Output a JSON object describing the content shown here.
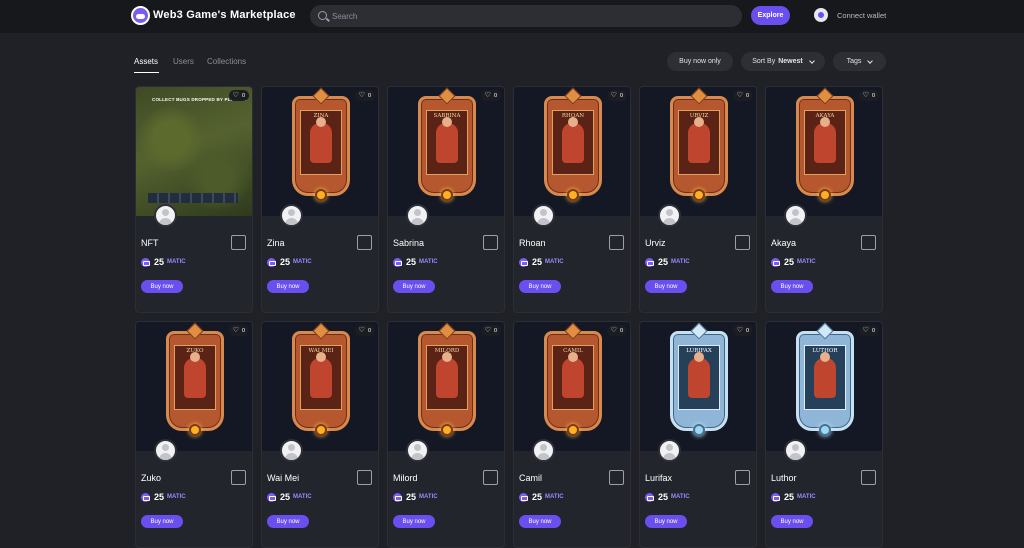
{
  "header": {
    "brand": "Web3 Game's Marketplace",
    "search_placeholder": "Search",
    "explore_label": "Explore",
    "wallet_label": "Connect wallet"
  },
  "tabs": [
    {
      "label": "Assets",
      "active": true
    },
    {
      "label": "Users",
      "active": false
    },
    {
      "label": "Collections",
      "active": false
    }
  ],
  "filters": {
    "buy_now": "Buy now only",
    "sort_prefix": "Sort By",
    "sort_value": "Newest",
    "tags": "Tags"
  },
  "nft_caption": "COLLECT BUGS DROPPED BY PLAYERS",
  "cards": [
    {
      "name": "NFT",
      "hero": "",
      "likes": "0",
      "price": "25",
      "unit": "MATIC",
      "buy": "Buy now",
      "frame": "nft"
    },
    {
      "name": "Zina",
      "hero": "Zina",
      "likes": "0",
      "price": "25",
      "unit": "MATIC",
      "buy": "Buy now",
      "frame": "fire"
    },
    {
      "name": "Sabrina",
      "hero": "SABRINA",
      "likes": "0",
      "price": "25",
      "unit": "MATIC",
      "buy": "Buy now",
      "frame": "fire"
    },
    {
      "name": "Rhoan",
      "hero": "RHOAN",
      "likes": "0",
      "price": "25",
      "unit": "MATIC",
      "buy": "Buy now",
      "frame": "fire"
    },
    {
      "name": "Urviz",
      "hero": "URVIZ",
      "likes": "0",
      "price": "25",
      "unit": "MATIC",
      "buy": "Buy now",
      "frame": "fire"
    },
    {
      "name": "Akaya",
      "hero": "AKAYA",
      "likes": "0",
      "price": "25",
      "unit": "MATIC",
      "buy": "Buy now",
      "frame": "fire"
    },
    {
      "name": "Zuko",
      "hero": "ZUKO",
      "likes": "0",
      "price": "25",
      "unit": "MATIC",
      "buy": "Buy now",
      "frame": "fire"
    },
    {
      "name": "Wai Mei",
      "hero": "WAI MEI",
      "likes": "0",
      "price": "25",
      "unit": "MATIC",
      "buy": "Buy now",
      "frame": "fire"
    },
    {
      "name": "Milord",
      "hero": "MILORD",
      "likes": "0",
      "price": "25",
      "unit": "MATIC",
      "buy": "Buy now",
      "frame": "fire"
    },
    {
      "name": "Camil",
      "hero": "Camil",
      "likes": "0",
      "price": "25",
      "unit": "MATIC",
      "buy": "Buy now",
      "frame": "fire"
    },
    {
      "name": "Lurifax",
      "hero": "LURIFAX",
      "likes": "0",
      "price": "25",
      "unit": "MATIC",
      "buy": "Buy now",
      "frame": "ice"
    },
    {
      "name": "Luthor",
      "hero": "LUTHOR",
      "likes": "0",
      "price": "25",
      "unit": "MATIC",
      "buy": "Buy now",
      "frame": "ice"
    }
  ]
}
